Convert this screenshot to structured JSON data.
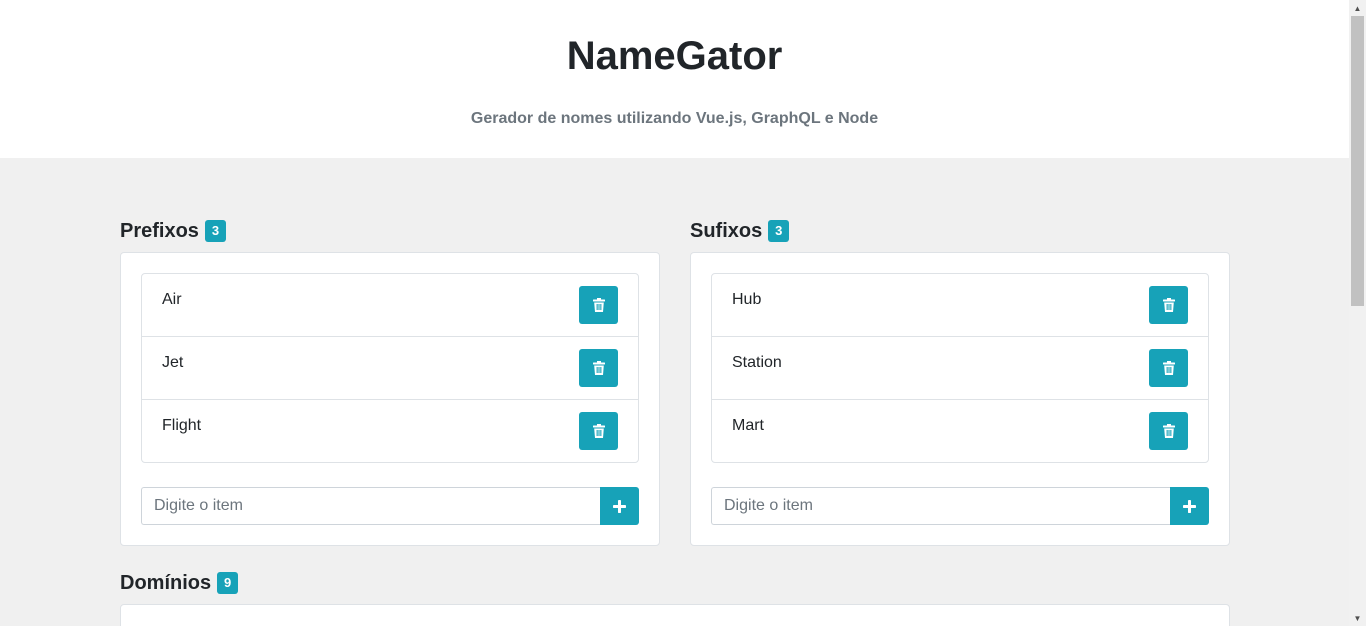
{
  "header": {
    "title": "NameGator",
    "subtitle": "Gerador de nomes utilizando Vue.js, GraphQL e Node"
  },
  "prefixes": {
    "title": "Prefixos",
    "count": "3",
    "items": [
      "Air",
      "Jet",
      "Flight"
    ],
    "input_placeholder": "Digite o item"
  },
  "suffixes": {
    "title": "Sufixos",
    "count": "3",
    "items": [
      "Hub",
      "Station",
      "Mart"
    ],
    "input_placeholder": "Digite o item"
  },
  "domains": {
    "title": "Domínios",
    "count": "9"
  },
  "colors": {
    "accent": "#17a2b8",
    "background": "#f0f0f0",
    "header_bg": "#ffffff"
  },
  "icons": {
    "delete": "trash-icon",
    "add": "plus-icon"
  }
}
